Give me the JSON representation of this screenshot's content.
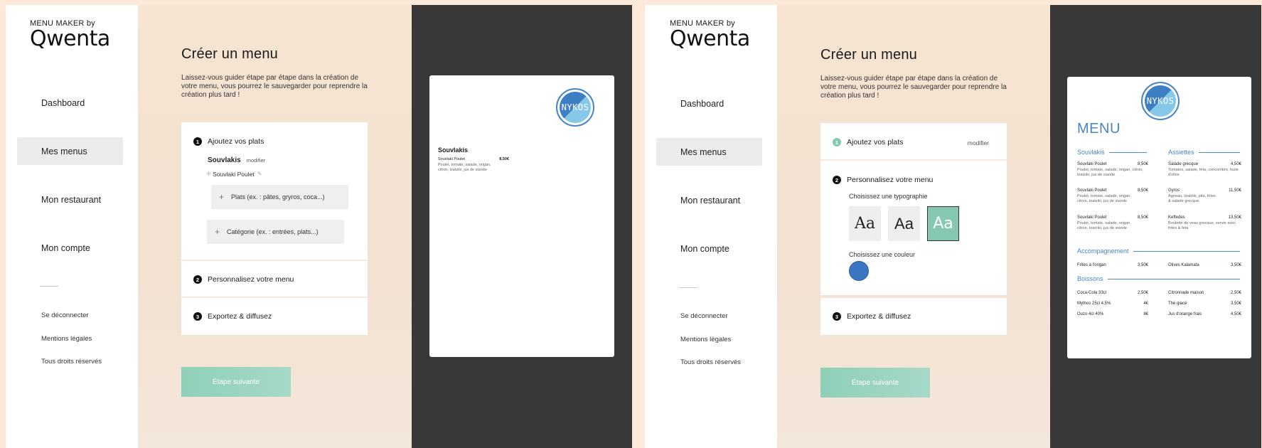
{
  "brand": {
    "small": "MENU MAKER by",
    "big": "Qwenta"
  },
  "nav": {
    "items": [
      "Dashboard",
      "Mes menus",
      "Mon restaurant",
      "Mon compte"
    ],
    "active": "Mes menus",
    "footer": [
      "Se déconnecter",
      "Mentions légales",
      "Tous droits réservés"
    ]
  },
  "main": {
    "title": "Créer un menu",
    "description": "Laissez-vous guider étape par étape dans la création de votre menu, vous pourrez le sauvegarder pour reprendre la création plus tard !",
    "next_button": "Étape suivante"
  },
  "step1": {
    "number": "1",
    "label": "Ajoutez vos plats",
    "category": "Souvlakis",
    "modify": "modifier",
    "dish": "Souvlaki Poulet",
    "add_dish_placeholder": "Plats (ex. : pâtes, gryros, coca...)",
    "add_category_placeholder": "Catégorie (ex. : entrées, plats...)"
  },
  "step2": {
    "number": "2",
    "label": "Personnalisez votre menu",
    "typo_label": "Choisissez une typographie",
    "typo_samples": [
      "Aa",
      "Aa",
      "Aa"
    ],
    "color_label": "Choisissez une couleur",
    "selected_color": "#3a77c2"
  },
  "step3": {
    "number": "3",
    "label": "Exportez & diffusez"
  },
  "preview1": {
    "logo": "NYKOS",
    "section": "Souvlakis",
    "item": {
      "name": "Souvlaki Poulet",
      "price": "8,50€",
      "desc": "Poulet, tomate, salade, origan, citron, tzatziki, jus de viande"
    }
  },
  "preview2": {
    "logo": "NYKOS",
    "menu_title": "MENU",
    "souvlakis": {
      "title": "Souvlakis",
      "items": [
        {
          "name": "Souvlaki Poulet",
          "price": "8,50€",
          "desc": "Poulet, tomate, salade, origan, citron, tzatziki, jus de viande"
        },
        {
          "name": "Souvlaki Poulet",
          "price": "8,50€",
          "desc": "Poulet, tomate, salade, origan, citron, tzatziki, jus de viande"
        },
        {
          "name": "Souvlaki Poulet",
          "price": "8,50€",
          "desc": "Poulet, tomate, salade, origan, citron, tzatziki, jus de viande"
        }
      ]
    },
    "assiettes": {
      "title": "Assiettes",
      "items": [
        {
          "name": "Salade grecque",
          "price": "4,50€",
          "desc": "Tomates, salade, feta, concombre, huile d'olive"
        },
        {
          "name": "Gyros",
          "price": "11,50€",
          "desc": "Agneau, tzatziki, pita, frites & salade grecque"
        },
        {
          "name": "Keftedes",
          "price": "13,50€",
          "desc": "Boulette de veau grecque, servie avec frites & feta"
        }
      ]
    },
    "accompagnement": {
      "title": "Accompagnement",
      "items": [
        {
          "name": "Frites à l'origan",
          "price": "3,50€"
        },
        {
          "name": "Olives Kalamata",
          "price": "3,50€"
        }
      ]
    },
    "boissons": {
      "title": "Boissons",
      "items": [
        {
          "name": "Coca-Cola 33cl",
          "price": "2,50€"
        },
        {
          "name": "Citronnade maison",
          "price": "2,50€"
        },
        {
          "name": "Mythos 25cl 4,5%",
          "price": "4€"
        },
        {
          "name": "Thé glacé",
          "price": "3,50€"
        },
        {
          "name": "Ouzo 4cl 40%",
          "price": "8€"
        },
        {
          "name": "Jus d'orange frais",
          "price": "4,50€"
        }
      ]
    }
  }
}
